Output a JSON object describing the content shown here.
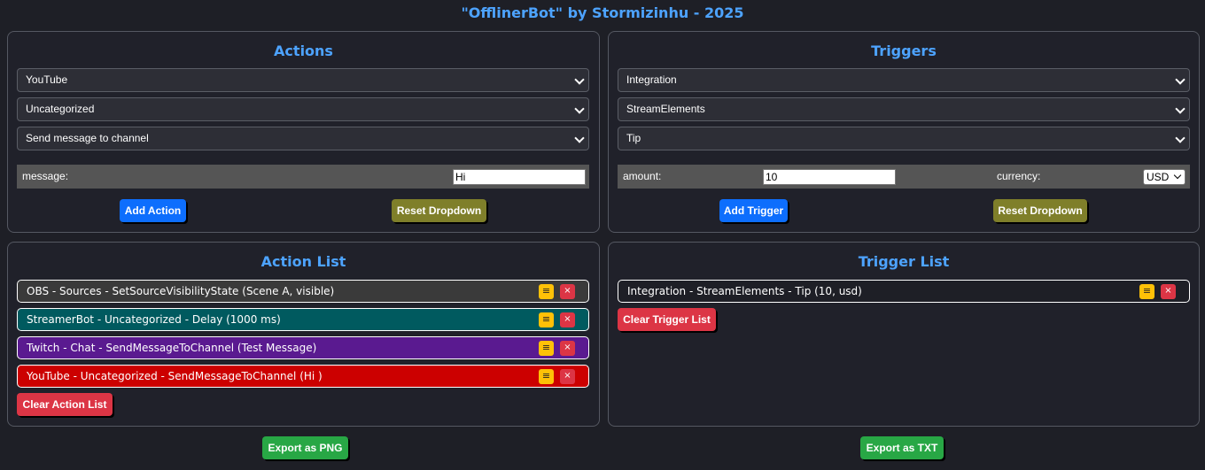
{
  "app": {
    "title": "\"OfflinerBot\" by Stormizinhu - 2025"
  },
  "actions_panel": {
    "title": "Actions",
    "platform_select": "YouTube",
    "category_select": "Uncategorized",
    "action_select": "Send message to channel",
    "message_label": "message:",
    "message_value": "Hi",
    "add_label": "Add Action",
    "reset_label": "Reset Dropdown"
  },
  "triggers_panel": {
    "title": "Triggers",
    "type_select": "Integration",
    "service_select": "StreamElements",
    "event_select": "Tip",
    "amount_label": "amount:",
    "amount_value": "10",
    "currency_label": "currency:",
    "currency_value": "USD",
    "add_label": "Add Trigger",
    "reset_label": "Reset Dropdown"
  },
  "action_list": {
    "title": "Action List",
    "items": [
      {
        "text": "OBS - Sources - SetSourceVisibilityState (Scene A, visible)",
        "color": "#3a3a3a"
      },
      {
        "text": "StreamerBot - Uncategorized - Delay (1000 ms)",
        "color": "#005a5f"
      },
      {
        "text": "Twitch - Chat - SendMessageToChannel (Test Message)",
        "color": "#5a1a90"
      },
      {
        "text": "YouTube - Uncategorized - SendMessageToChannel (Hi )",
        "color": "#cc0000"
      }
    ],
    "clear_label": "Clear Action List"
  },
  "trigger_list": {
    "title": "Trigger List",
    "items": [
      {
        "text": "Integration - StreamElements - Tip (10, usd)",
        "color": "#1e1f26"
      }
    ],
    "clear_label": "Clear Trigger List"
  },
  "export": {
    "png_label": "Export as PNG",
    "txt_label": "Export as TXT"
  },
  "icons": {
    "edit": "≡",
    "delete": "×"
  }
}
